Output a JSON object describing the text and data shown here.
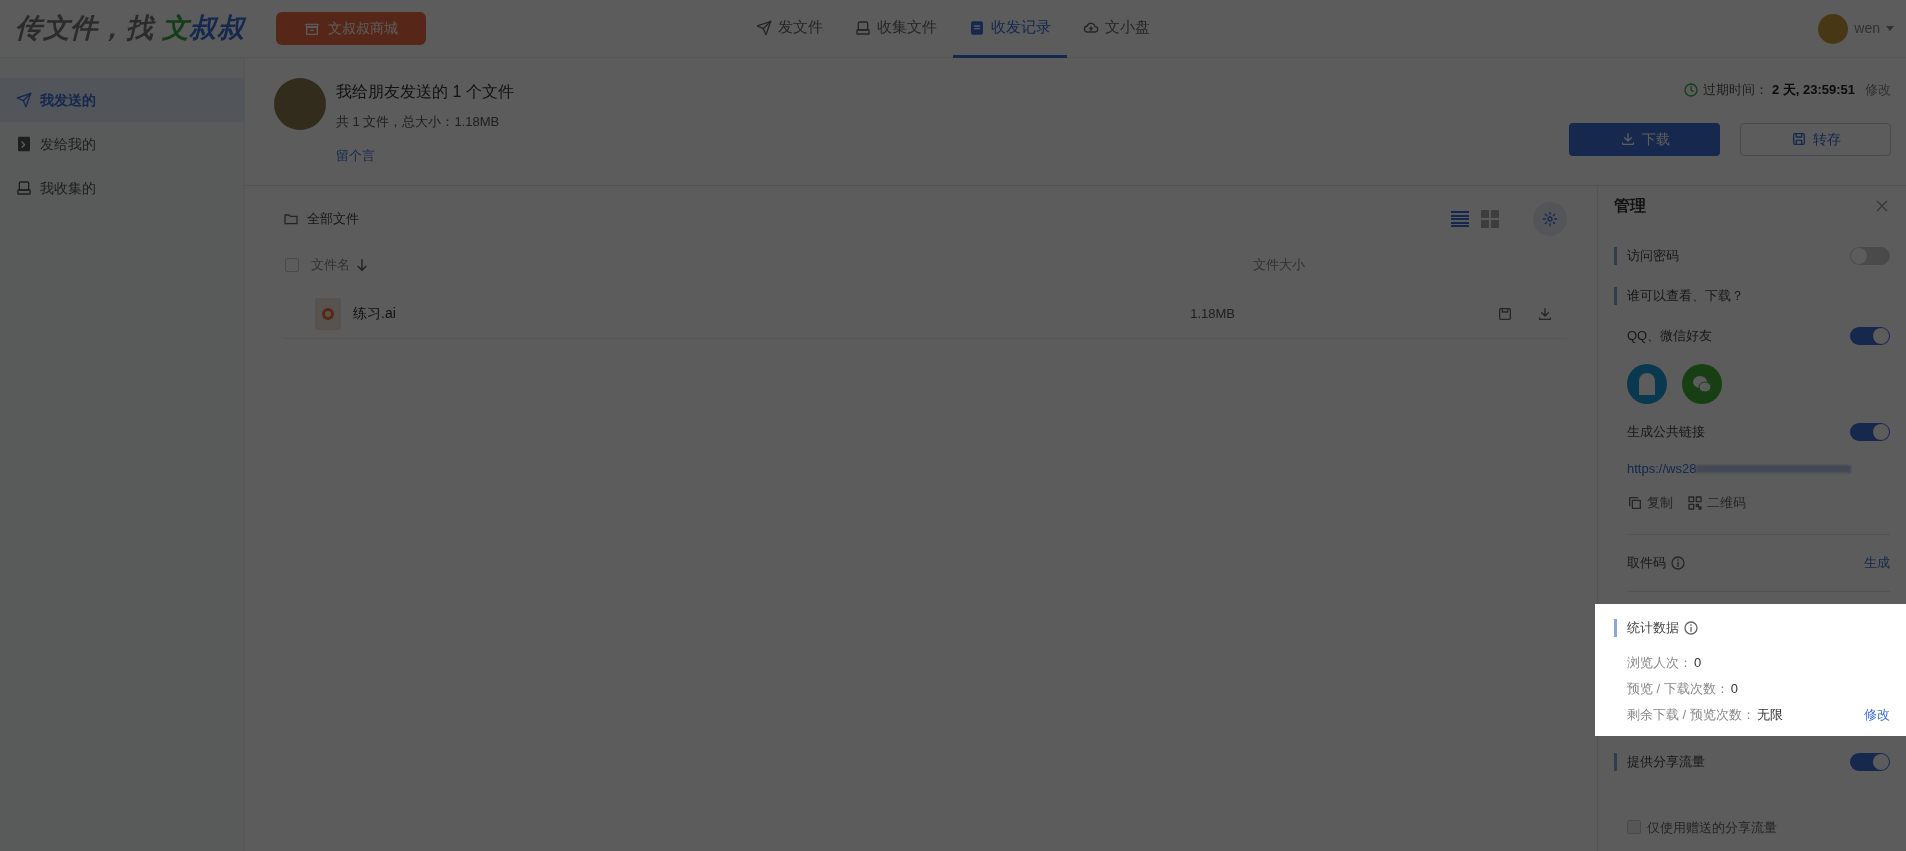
{
  "header": {
    "logo": {
      "prefix": "传文件，找 ",
      "brand_green": "文",
      "brand_blue": "叔叔"
    },
    "store_button": "文叔叔商城",
    "nav_tabs": [
      {
        "label": "发文件",
        "selected": false,
        "kind": "send"
      },
      {
        "label": "收集文件",
        "selected": false,
        "kind": "collect"
      },
      {
        "label": "收发记录",
        "selected": true,
        "kind": "records"
      },
      {
        "label": "文小盘",
        "selected": false,
        "kind": "cloud"
      }
    ],
    "user": {
      "name": "wen"
    }
  },
  "sidebar": {
    "items": [
      {
        "label": "我发送的",
        "selected": true,
        "kind": "send"
      },
      {
        "label": "发给我的",
        "selected": false,
        "kind": "inbox"
      },
      {
        "label": "我收集的",
        "selected": false,
        "kind": "collect"
      }
    ]
  },
  "transfer": {
    "title": "我给朋友发送的 1 个文件",
    "summary": "共 1 文件，总大小：1.18MB",
    "message_link": "留个言",
    "expiry_label": "过期时间：",
    "expiry_value": "2 天, 23:59:51",
    "expiry_edit": "修改",
    "buttons": [
      {
        "label": "下载",
        "kind": "primary"
      },
      {
        "label": "转存",
        "kind": "secondary"
      }
    ]
  },
  "files": {
    "breadcrumb": "全部文件",
    "view_list_selected": true,
    "select_all_checked": false,
    "columns": [
      "文件名",
      "文件大小"
    ],
    "rows": [
      {
        "name": "练习.ai",
        "size": "1.18MB"
      }
    ]
  },
  "manage_panel": {
    "title": "管理",
    "items": [
      {
        "kind": "section_toggle",
        "label": "访问密码",
        "on": false
      },
      {
        "kind": "section",
        "label": "谁可以查看、下载？"
      },
      {
        "kind": "toggle",
        "label": "QQ、微信好友",
        "on": true
      },
      {
        "kind": "share_icons"
      },
      {
        "kind": "toggle",
        "label": "生成公共链接",
        "on": true
      },
      {
        "kind": "link",
        "label": "https://ws28"
      },
      {
        "kind": "link_actions",
        "copy": "复制",
        "qr": "二维码"
      },
      {
        "kind": "pickup",
        "label": "取件码",
        "action": "生成"
      }
    ],
    "stats": {
      "title": "统计数据",
      "rows": [
        {
          "label": "浏览人次：",
          "value": "0"
        },
        {
          "label": "预览 / 下载次数：",
          "value": "0"
        },
        {
          "label": "剩余下载 / 预览次数：",
          "value": "无限",
          "action": "修改"
        }
      ]
    },
    "traffic": {
      "label": "提供分享流量",
      "on": true,
      "option": {
        "label": "仅使用赠送的分享流量",
        "checked": false
      }
    }
  }
}
